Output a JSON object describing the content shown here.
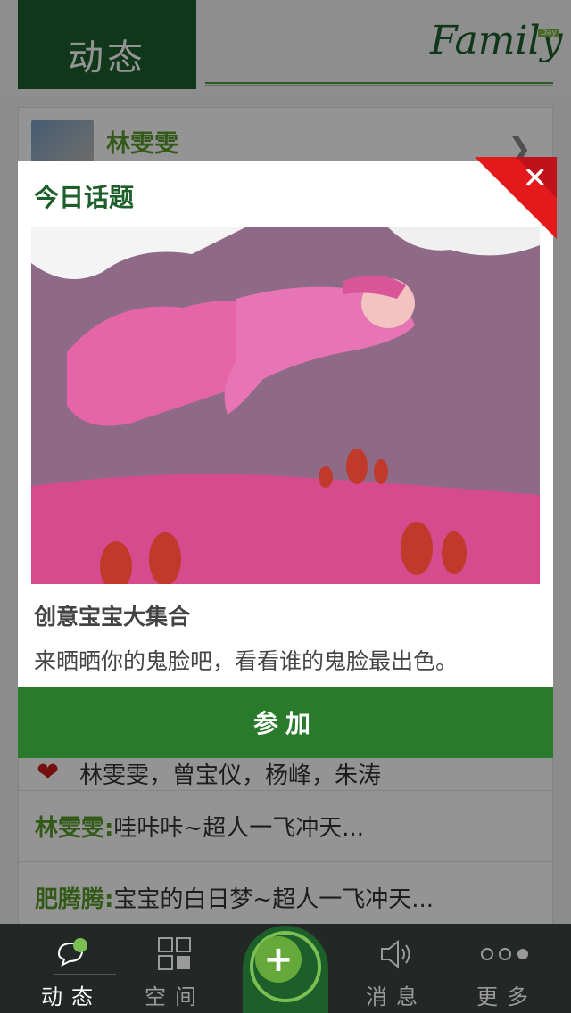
{
  "header": {
    "title": "动态",
    "logo": "Family",
    "logo_badge": "Day"
  },
  "feed": {
    "author_name": "林雯雯",
    "chevron": "❯",
    "likes": "林雯雯，曾宝仪，杨峰，朱涛",
    "comments": [
      {
        "name": "林雯雯:",
        "text": "哇咔咔~超人一飞冲天..."
      },
      {
        "name": "肥腾腾:",
        "text": "宝宝的白日梦~超人一飞冲天..."
      }
    ]
  },
  "dialog": {
    "title": "今日话题",
    "close": "✕",
    "topic_name": "创意宝宝大集合",
    "topic_desc": "来晒晒你的鬼脸吧，看看谁的鬼脸最出色。",
    "join_label": "参加"
  },
  "tabbar": {
    "tabs": [
      {
        "label": "动态",
        "icon": "chat-bubble-icon",
        "active": true
      },
      {
        "label": "空间",
        "icon": "grid-icon",
        "active": false
      },
      {
        "label": "消息",
        "icon": "speaker-icon",
        "active": false
      },
      {
        "label": "更多",
        "icon": "dots-icon",
        "active": false
      }
    ],
    "center_icon": "add-icon",
    "center_symbol": "+"
  },
  "colors": {
    "brand_green": "#1d5f2b",
    "accent_green": "#5a9b2e",
    "button_green": "#2a7a2b",
    "close_red": "#e3191c",
    "tabbar_bg": "#232725"
  }
}
